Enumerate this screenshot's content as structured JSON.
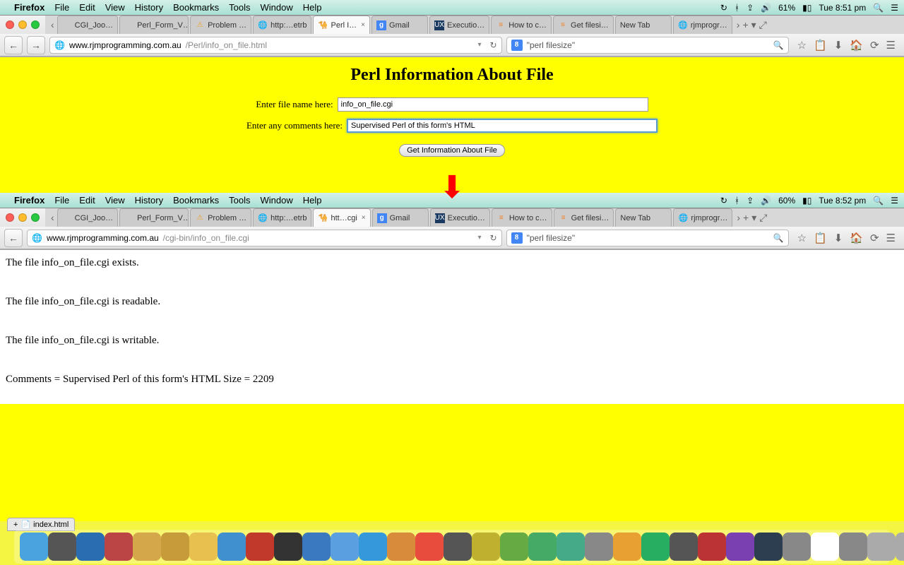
{
  "menubar1": {
    "app": "Firefox",
    "items": [
      "File",
      "Edit",
      "View",
      "History",
      "Bookmarks",
      "Tools",
      "Window",
      "Help"
    ],
    "battery": "61%",
    "time": "Tue 8:51 pm"
  },
  "menubar2": {
    "app": "Firefox",
    "items": [
      "File",
      "Edit",
      "View",
      "History",
      "Bookmarks",
      "Tools",
      "Window",
      "Help"
    ],
    "battery": "60%",
    "time": "Tue 8:52 pm"
  },
  "tabs": [
    {
      "label": "CGI_Joo…",
      "icon": "nav"
    },
    {
      "label": "Perl_Form_V…",
      "icon": "generic"
    },
    {
      "label": "Problem …",
      "icon": "warn"
    },
    {
      "label": "http:…etrb",
      "icon": "globe"
    },
    {
      "label": "Perl I…",
      "icon": "perl",
      "active": true,
      "close": true
    },
    {
      "label": "Gmail",
      "icon": "google"
    },
    {
      "label": "Executio…",
      "icon": "ux"
    },
    {
      "label": "How to c…",
      "icon": "stack"
    },
    {
      "label": "Get filesi…",
      "icon": "stack"
    },
    {
      "label": "New Tab",
      "icon": "generic"
    },
    {
      "label": "rjmprogr…",
      "icon": "globe"
    }
  ],
  "tabs2_active_label": "htt…cgi",
  "url1": {
    "host": "www.rjmprogramming.com.au",
    "path": "/Perl/info_on_file.html"
  },
  "url2": {
    "host": "www.rjmprogramming.com.au",
    "path": "/cgi-bin/info_on_file.cgi"
  },
  "search": {
    "text": "\"perl filesize\""
  },
  "page1": {
    "title": "Perl Information About File",
    "label_filename": "Enter file name here:",
    "value_filename": "info_on_file.cgi",
    "label_comments": "Enter any comments here:",
    "value_comments": "Supervised Perl of this form's HTML",
    "submit": "Get Information About File"
  },
  "page2": {
    "line1": "The file info_on_file.cgi exists.",
    "line2": "The file info_on_file.cgi is readable.",
    "line3": "The file info_on_file.cgi is writable.",
    "line4": "Comments = Supervised Perl of this form's HTML Size = 2209"
  },
  "finder_tab": "index.html",
  "dock_colors": [
    "#4aa3df",
    "#555",
    "#2a6db0",
    "#b44",
    "#d4a84a",
    "#c79a3a",
    "#e8c050",
    "#4090d0",
    "#c0392b",
    "#333",
    "#3a78c0",
    "#5aa0e0",
    "#3498db",
    "#d88b3a",
    "#e74c3c",
    "#555",
    "#c0b030",
    "#6a4",
    "#4a6",
    "#4a8",
    "#888",
    "#e8a030",
    "#27ae60",
    "#555",
    "#b33",
    "#7a3fb0",
    "#2c3e50",
    "#888",
    "#fff",
    "#888",
    "#aaa",
    "#aaa",
    "#555"
  ]
}
